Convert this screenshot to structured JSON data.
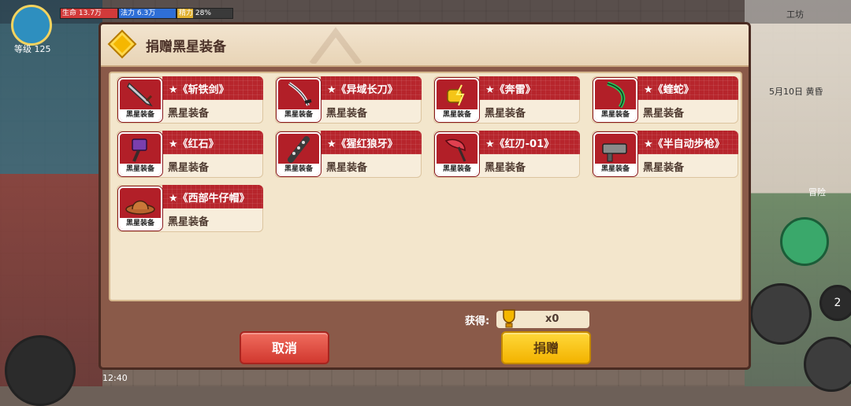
{
  "hud": {
    "hp_label": "生命",
    "hp_value": "13.7万",
    "mp_label": "法力",
    "mp_value": "6.3万",
    "en_label": "精力",
    "en_value": "28%",
    "level": "等级 125",
    "date": "5月10日 黄昏",
    "time": "12:40",
    "workshop": "工坊",
    "adventure": "冒险",
    "count": "2"
  },
  "dialog": {
    "title": "捐赠黑星装备",
    "items": [
      {
        "name": "★《斩铁剑》",
        "category": "黑星装备",
        "tag": "黑星装备"
      },
      {
        "name": "★《异域长刀》",
        "category": "黑星装备",
        "tag": "黑星装备"
      },
      {
        "name": "★《奔雷》",
        "category": "黑星装备",
        "tag": "黑星装备"
      },
      {
        "name": "★《蝰蛇》",
        "category": "黑星装备",
        "tag": "黑星装备"
      },
      {
        "name": "★《红石》",
        "category": "黑星装备",
        "tag": "黑星装备"
      },
      {
        "name": "★《猩红狼牙》",
        "category": "黑星装备",
        "tag": "黑星装备"
      },
      {
        "name": "★《红刃-01》",
        "category": "黑星装备",
        "tag": "黑星装备"
      },
      {
        "name": "★《半自动步枪》",
        "category": "黑星装备",
        "tag": "黑星装备"
      },
      {
        "name": "★《西部牛仔帽》",
        "category": "黑星装备",
        "tag": "黑星装备"
      }
    ],
    "reward_label": "获得:",
    "reward_count": "x0",
    "cancel_label": "取消",
    "donate_label": "捐赠"
  }
}
